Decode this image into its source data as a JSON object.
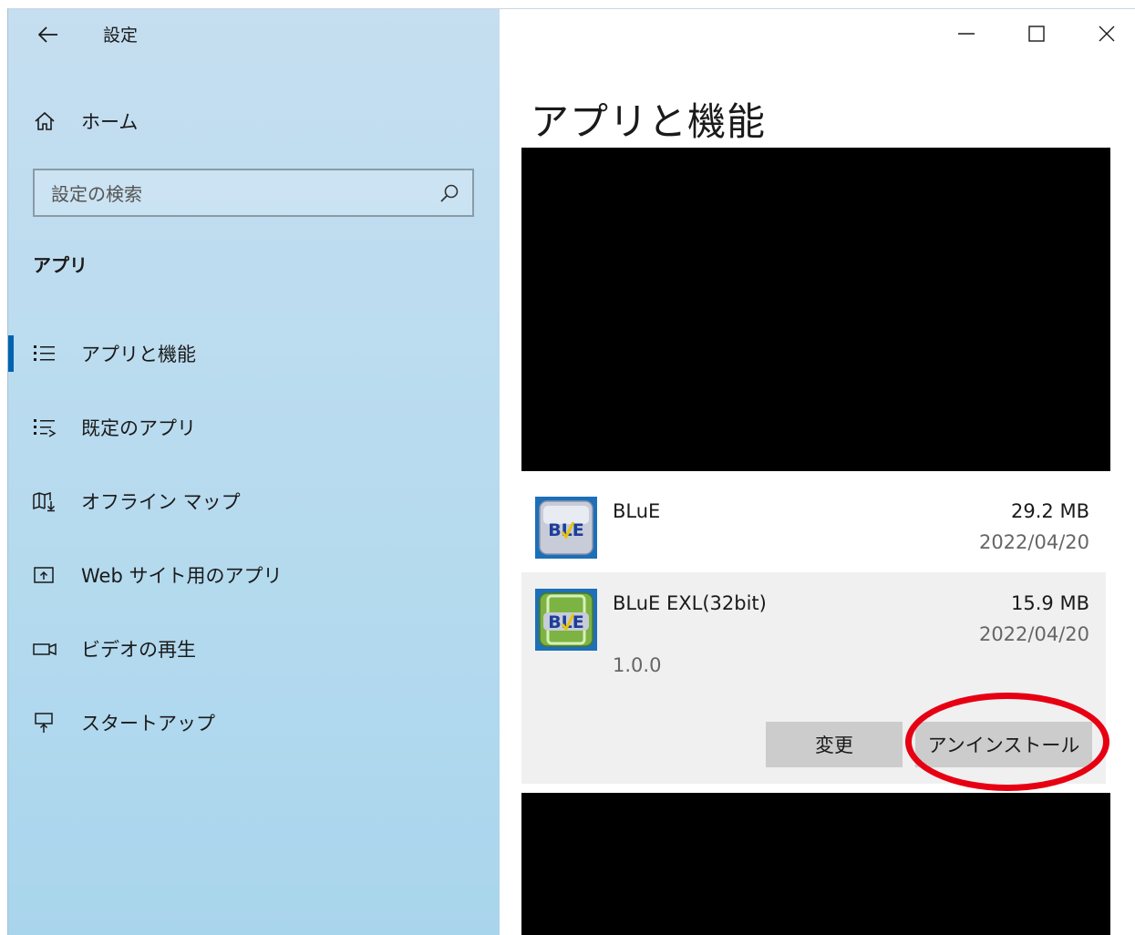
{
  "window": {
    "title": "設定",
    "controls": {
      "minimize": "minimize",
      "maximize": "maximize",
      "close": "close"
    }
  },
  "sidebar": {
    "home_label": "ホーム",
    "search_placeholder": "設定の検索",
    "section_header": "アプリ",
    "items": [
      {
        "label": "アプリと機能",
        "icon": "apps-features-icon",
        "selected": true
      },
      {
        "label": "既定のアプリ",
        "icon": "default-apps-icon",
        "selected": false
      },
      {
        "label": "オフライン マップ",
        "icon": "offline-maps-icon",
        "selected": false
      },
      {
        "label": "Web サイト用のアプリ",
        "icon": "apps-for-websites-icon",
        "selected": false
      },
      {
        "label": "ビデオの再生",
        "icon": "video-playback-icon",
        "selected": false
      },
      {
        "label": "スタートアップ",
        "icon": "startup-icon",
        "selected": false
      }
    ]
  },
  "main": {
    "title": "アプリと機能",
    "apps": [
      {
        "name": "BLuE",
        "size": "29.2 MB",
        "date": "2022/04/20",
        "icon_text": "BLE"
      },
      {
        "name": "BLuE EXL(32bit)",
        "size": "15.9 MB",
        "date": "2022/04/20",
        "version": "1.0.0",
        "icon_text": "BLE",
        "expanded": true
      }
    ],
    "buttons": {
      "modify": "変更",
      "uninstall": "アンインストール"
    }
  },
  "colors": {
    "accent": "#0063b1",
    "highlight_ring": "#e60012",
    "sidebar_bg": "#b8dbef",
    "expanded_row_bg": "#f0f0f0",
    "button_bg": "#cccccc"
  }
}
